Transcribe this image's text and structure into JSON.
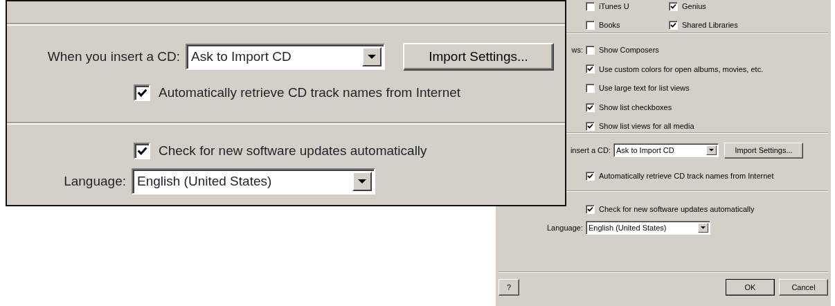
{
  "dialog": {
    "media_options": [
      {
        "label": "iTunes U",
        "checked": false
      },
      {
        "label": "Genius",
        "checked": true
      },
      {
        "label": "Books",
        "checked": false
      },
      {
        "label": "Shared Libraries",
        "checked": true
      }
    ],
    "views_label": "ws:",
    "view_options": [
      {
        "label": "Show Composers",
        "checked": false
      },
      {
        "label": "Use custom colors for open albums, movies, etc.",
        "checked": true
      },
      {
        "label": "Use large text for list views",
        "checked": false
      },
      {
        "label": "Show list checkboxes",
        "checked": true
      },
      {
        "label": "Show list views for all media",
        "checked": true
      }
    ],
    "cd_insert": {
      "label": "insert a CD:",
      "value": "Ask to Import CD",
      "button": "Import Settings..."
    },
    "retrieve_names": {
      "label": "Automatically retrieve CD track names from Internet",
      "checked": true
    },
    "check_updates": {
      "label": "Check for new software updates automatically",
      "checked": true
    },
    "language": {
      "label": "Language:",
      "value": "English (United States)"
    },
    "help_button": "?",
    "ok_button": "OK",
    "cancel_button": "Cancel"
  },
  "magnified_inset": {
    "cd_insert": {
      "label": "When you insert a CD:",
      "value": "Ask to Import CD",
      "button": "Import Settings..."
    },
    "retrieve_names": {
      "label": "Automatically retrieve CD track names from Internet",
      "checked": true
    },
    "check_updates": {
      "label": "Check for new software updates automatically",
      "checked": true
    },
    "language": {
      "label": "Language:",
      "value": "English (United States)"
    }
  }
}
